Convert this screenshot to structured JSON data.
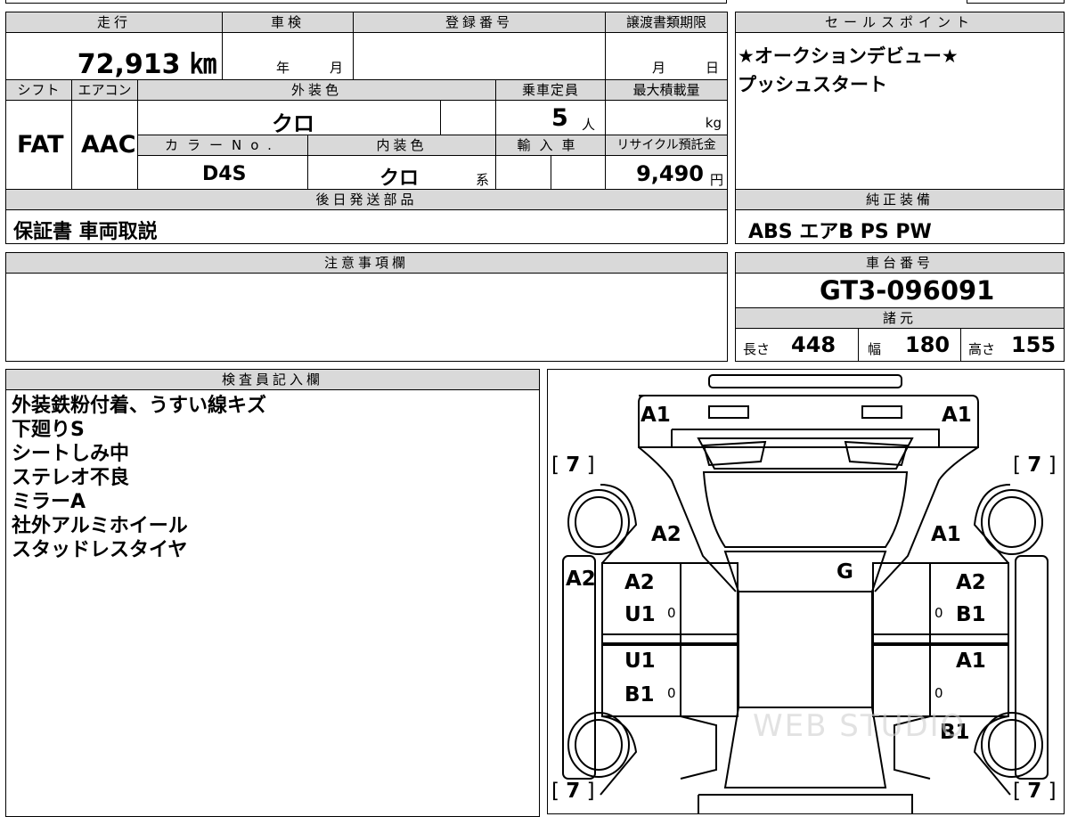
{
  "vehicle": {
    "mileage_label": "走行",
    "mileage": "72,913 ㎞",
    "shaken_label": "車検",
    "shaken_year": "年",
    "shaken_month": "月",
    "reg_label": "登録番号",
    "transfer_label": "譲渡書類期限",
    "transfer_month": "月",
    "transfer_day": "日",
    "shift_label": "シフト",
    "shift": "FAT",
    "ac_label": "エアコン",
    "ac": "AAC",
    "ext_color_label": "外装色",
    "ext_color": "クロ",
    "capacity_label": "乗車定員",
    "capacity": "5",
    "capacity_unit": "人",
    "maxload_label": "最大積載量",
    "maxload_unit": "kg",
    "color_no_label": "カラーNo.",
    "color_no": "D4S",
    "int_color_label": "内装色",
    "int_color": "クロ",
    "int_color_suffix": "系",
    "import_label": "輸入車",
    "recycle_label": "リサイクル預託金",
    "recycle_fee": "9,490",
    "recycle_unit": "円",
    "later_parts_label": "後日発送部品",
    "later_parts": "保証書 車両取説"
  },
  "sales": {
    "label": "セールスポイント",
    "lines": [
      "★オークションデビュー★",
      "プッシュスタート"
    ]
  },
  "equipment": {
    "label": "純正装備",
    "items": "ABS エアB PS PW"
  },
  "caution": {
    "label": "注意事項欄"
  },
  "chassis": {
    "label": "車台番号",
    "number": "GT3-096091"
  },
  "specs": {
    "label": "諸元",
    "length_label": "長さ",
    "length": "448",
    "width_label": "幅",
    "width": "180",
    "height_label": "高さ",
    "height": "155"
  },
  "inspector": {
    "label": "検査員記入欄",
    "notes": [
      "外装鉄粉付着、うすい線キズ",
      "下廻りS",
      "シートしみ中",
      "ステレオ不良",
      "ミラーA",
      "社外アルミホイール",
      "スタッドレスタイヤ"
    ]
  },
  "diagram": {
    "marks": {
      "front_left": "A1",
      "front_right": "A1",
      "tire_fl": "7",
      "tire_fr": "7",
      "tire_rl": "7",
      "tire_rr": "7",
      "fender_fl": "A2",
      "fender_fr": "A1",
      "roof": "G",
      "pillar_left": "A2",
      "door_fl_1": "A2",
      "door_fl_2": "U1",
      "door_fr_1": "A2",
      "door_fr_2": "B1",
      "door_rl_1": "U1",
      "door_rl_2": "B1",
      "door_rr_1": "A1",
      "rear_right": "B1",
      "zero_1": "0",
      "zero_2": "0",
      "zero_3": "0",
      "zero_4": "0"
    },
    "watermark": "WEB STUDIO"
  }
}
